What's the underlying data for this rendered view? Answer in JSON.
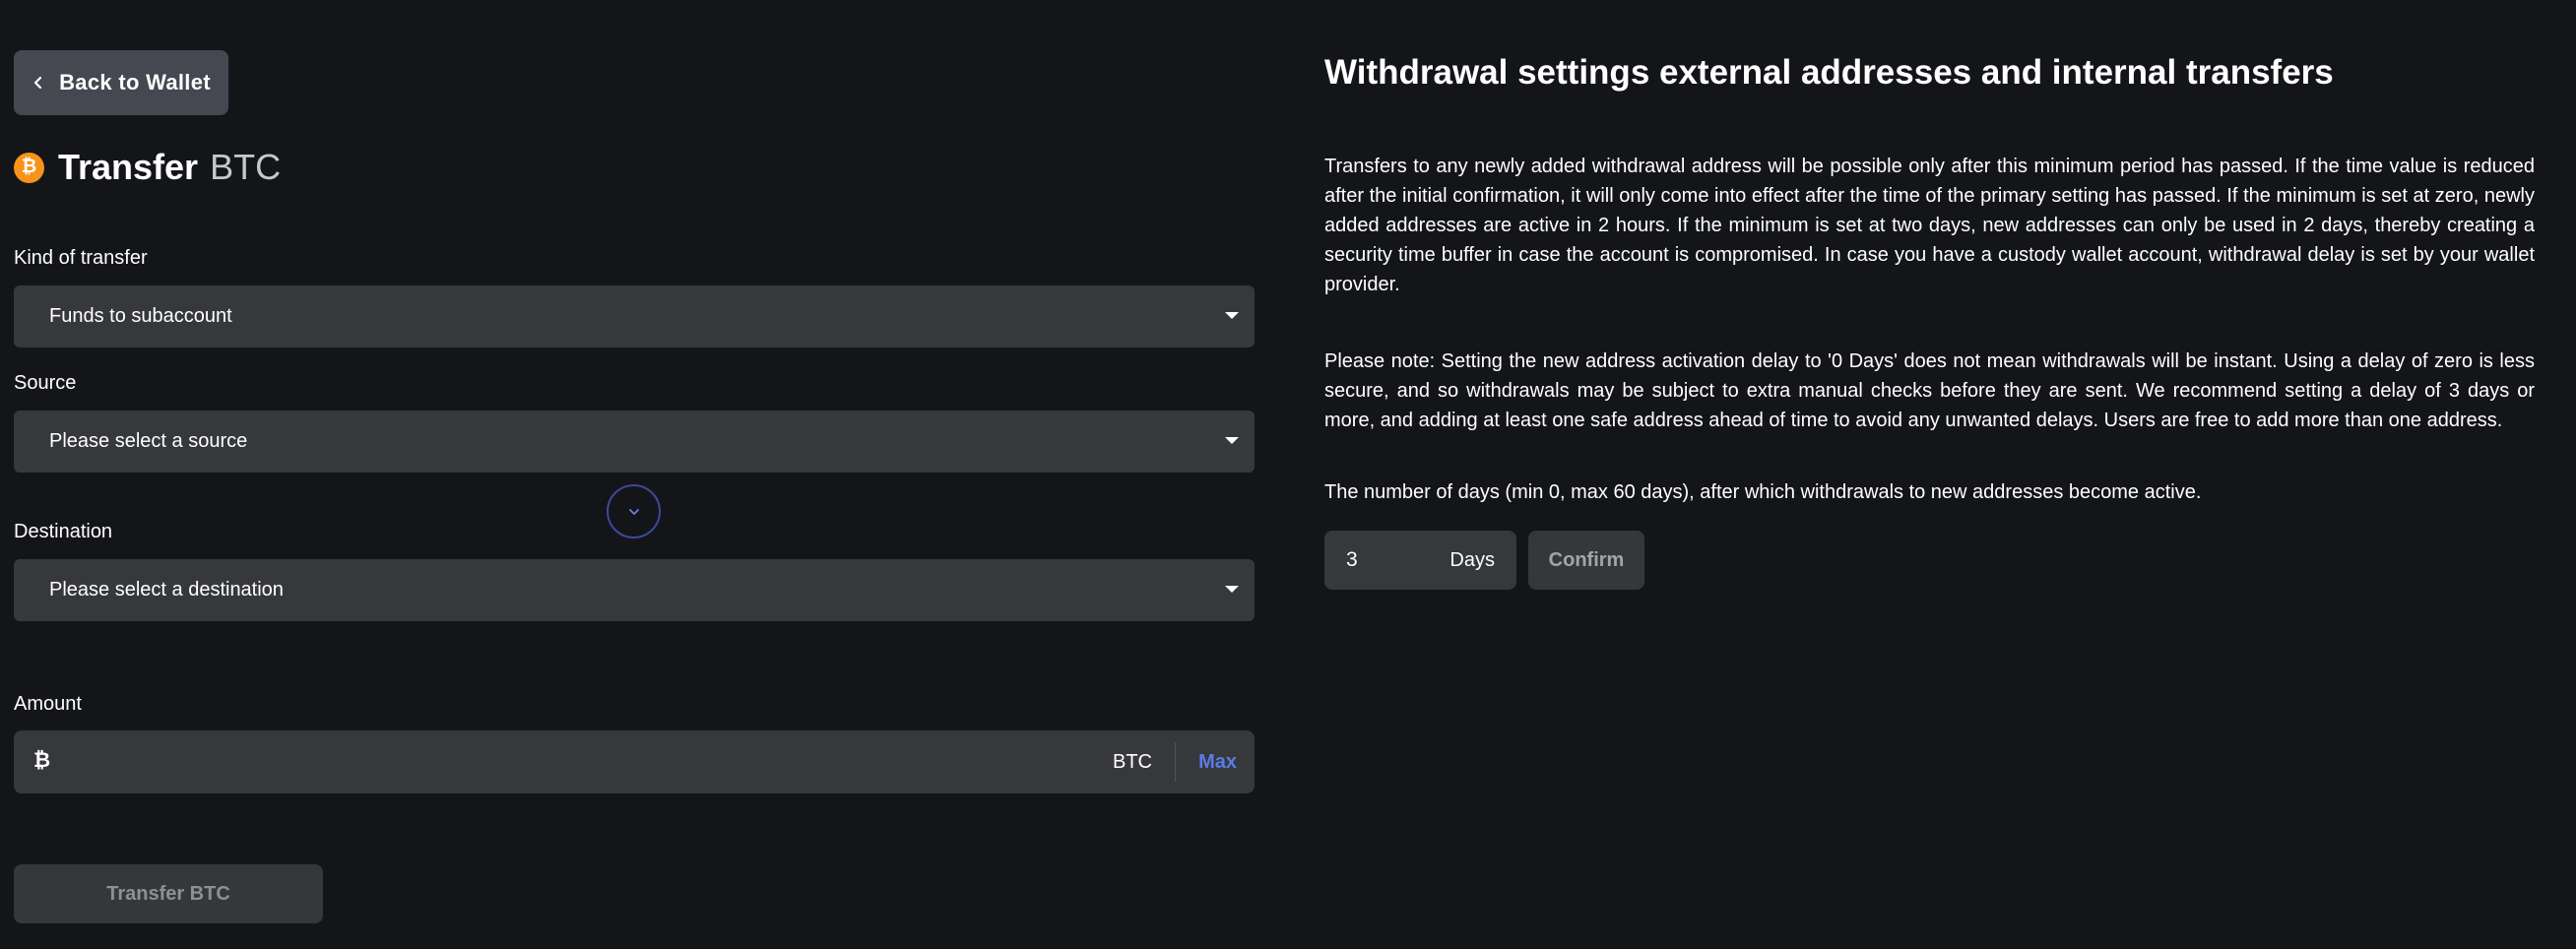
{
  "nav": {
    "back_label": "Back to Wallet"
  },
  "title": {
    "main": "Transfer",
    "currency": "BTC",
    "coin_glyph": "₿"
  },
  "form": {
    "kind": {
      "label": "Kind of transfer",
      "value": "Funds to subaccount"
    },
    "source": {
      "label": "Source",
      "placeholder": "Please select a source"
    },
    "destination": {
      "label": "Destination",
      "placeholder": "Please select a destination"
    },
    "amount": {
      "label": "Amount",
      "currency_glyph": "₿",
      "value": "",
      "unit": "BTC",
      "max_label": "Max"
    },
    "submit_label": "Transfer BTC"
  },
  "settings": {
    "heading": "Withdrawal settings external addresses and internal transfers",
    "paragraph_1": "Transfers to any newly added withdrawal address will be possible only after this minimum period has passed. If the time value is reduced after the initial confirmation, it will only come into effect after the time of the primary setting has passed. If the minimum is set at zero, newly added addresses are active in 2 hours. If the minimum is set at two days, new addresses can only be used in 2 days, thereby creating a security time buffer in case the account is compromised. In case you have a custody wallet account, withdrawal delay is set by your wallet provider.",
    "paragraph_2": "Please note: Setting the new address activation delay to '0 Days' does not mean withdrawals will be instant. Using a delay of zero is less secure, and so withdrawals may be subject to extra manual checks before they are sent. We recommend setting a delay of 3 days or more, and adding at least one safe address ahead of time to avoid any unwanted delays. Users are free to add more than one address.",
    "days_note": "The number of days (min 0, max 60 days), after which withdrawals to new addresses become active.",
    "days_value": "3",
    "days_unit": "Days",
    "confirm_label": "Confirm"
  },
  "colors": {
    "background": "#141519",
    "field": "#36383c",
    "accent_link": "#5b7ce6",
    "bitcoin": "#f7931a"
  },
  "icons": {
    "back": "chevron-left-icon",
    "coin": "bitcoin-icon",
    "swap": "chevron-down-icon",
    "dropdown": "caret-down-icon"
  }
}
